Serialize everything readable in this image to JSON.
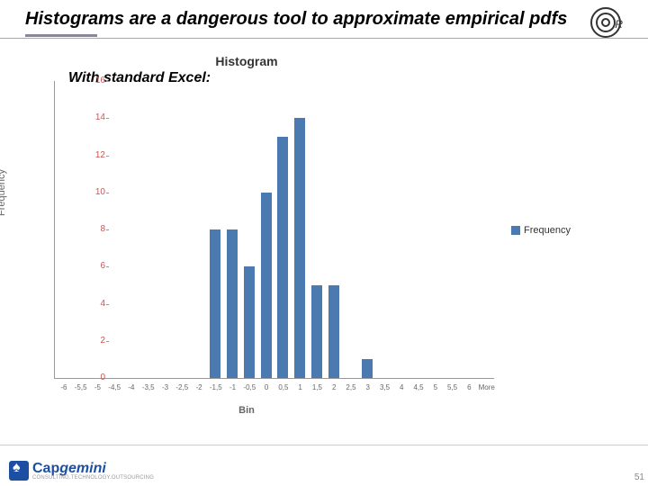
{
  "title": "Histograms are a dangerous tool to approximate empirical pdfs",
  "corner_label": "R",
  "annotation": "With standard Excel:",
  "chart_data": {
    "type": "bar",
    "title": "Histogram",
    "xlabel": "Bin",
    "ylabel": "Frequency",
    "legend": "Frequency",
    "ylim": [
      0,
      16
    ],
    "yticks": [
      0,
      2,
      4,
      6,
      8,
      10,
      12,
      14,
      16
    ],
    "categories": [
      "-6",
      "-5,5",
      "-5",
      "-4,5",
      "-4",
      "-3,5",
      "-3",
      "-2,5",
      "-2",
      "-1,5",
      "-1",
      "-0,5",
      "0",
      "0,5",
      "1",
      "1,5",
      "2",
      "2,5",
      "3",
      "3,5",
      "4",
      "4,5",
      "5",
      "5,5",
      "6",
      "More"
    ],
    "values": [
      0,
      0,
      0,
      0,
      0,
      0,
      0,
      0,
      0,
      8,
      8,
      6,
      10,
      13,
      14,
      5,
      5,
      0,
      1,
      0,
      0,
      0,
      0,
      0,
      0,
      0
    ]
  },
  "brand": {
    "name1": "Cap",
    "name2": "gemini",
    "sub": "CONSULTING.TECHNOLOGY.OUTSOURCING"
  },
  "page_number": "51"
}
